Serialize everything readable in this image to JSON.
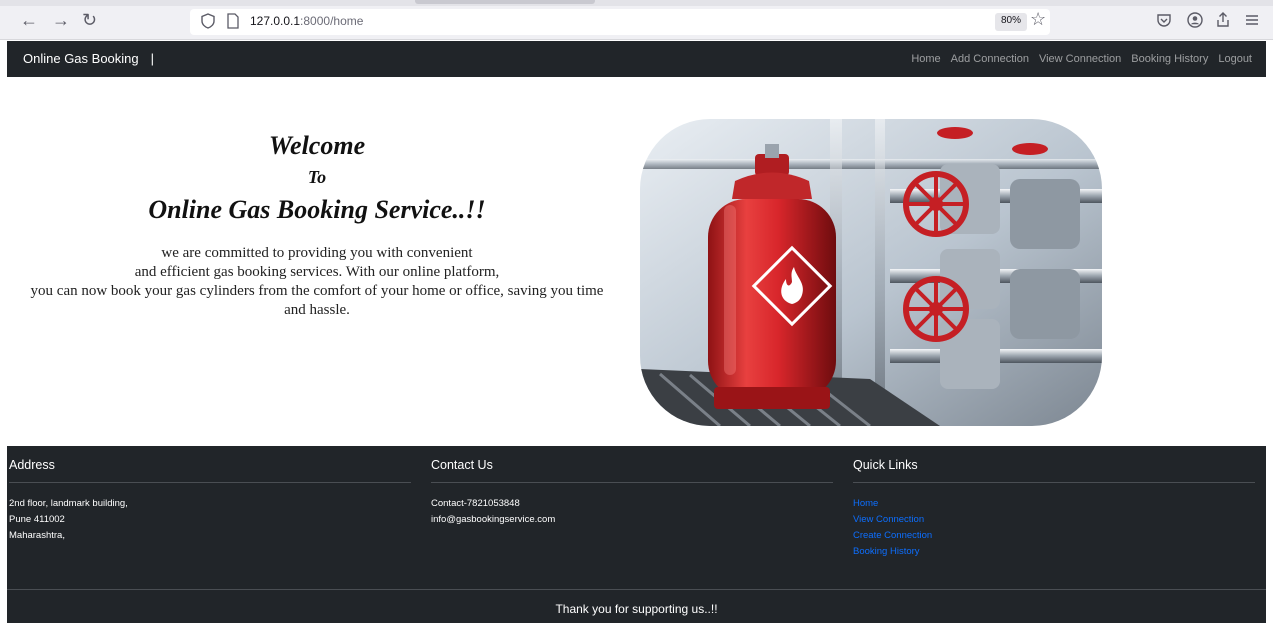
{
  "browser": {
    "url_host": "127.0.0.1",
    "url_path": ":8000/home",
    "zoom": "80%"
  },
  "navbar": {
    "brand": "Online Gas Booking",
    "separator": "|",
    "links": [
      "Home",
      "Add Connection",
      "View Connection",
      "Booking History",
      "Logout"
    ]
  },
  "hero": {
    "welcome": "Welcome",
    "to": "To",
    "service": "Online Gas Booking Service..!!",
    "lines": [
      "we are committed to providing you with convenient",
      "and efficient gas booking services. With our online platform,",
      "you can now book your gas cylinders from the comfort of your home or office, saving you time",
      "and hassle."
    ]
  },
  "footer": {
    "address": {
      "heading": "Address",
      "lines": [
        "2nd floor, landmark building,",
        "Pune 411002",
        "Maharashtra,"
      ]
    },
    "contact": {
      "heading": "Contact Us",
      "lines": [
        "Contact-7821053848",
        "info@gasbookingservice.com"
      ]
    },
    "quick_links": {
      "heading": "Quick Links",
      "links": [
        "Home",
        "View Connection",
        "Create Connection",
        "Booking History"
      ]
    },
    "thanks": "Thank you for supporting us..!!"
  },
  "colors": {
    "dark": "#212529",
    "link": "#0d6efd",
    "cylinder": "#d8262b"
  }
}
